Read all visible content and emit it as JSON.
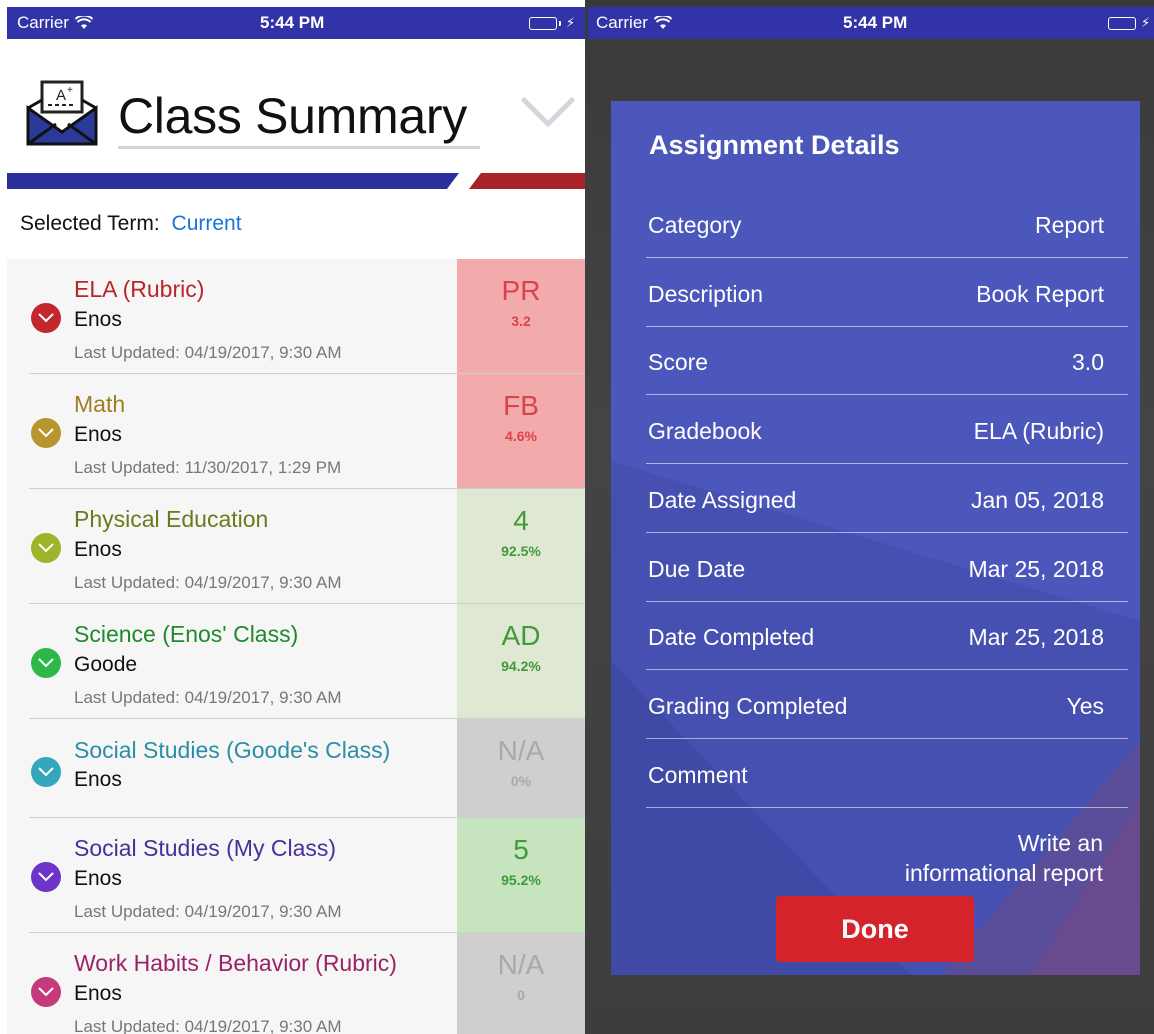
{
  "status_bar": {
    "carrier": "Carrier",
    "time": "5:44 PM"
  },
  "left": {
    "title": "Class Summary",
    "selected_term_label": "Selected Term:",
    "selected_term_value": "Current",
    "classes": [
      {
        "name": "ELA (Rubric)",
        "teacher": "Enos",
        "updated": "Last Updated: 04/19/2017, 9:30 AM",
        "grade": "PR",
        "score": "3.2",
        "name_color": "#b8262b",
        "dot_color": "#c4262d",
        "grade_bg": "#f3aaab",
        "grade_color": "#d9434a"
      },
      {
        "name": "Math",
        "teacher": "Enos",
        "updated": "Last Updated: 11/30/2017, 1:29 PM",
        "grade": "FB",
        "score": "4.6%",
        "name_color": "#a07e22",
        "dot_color": "#b8962e",
        "grade_bg": "#f3aaab",
        "grade_color": "#d9434a"
      },
      {
        "name": "Physical Education",
        "teacher": "Enos",
        "updated": "Last Updated: 04/19/2017, 9:30 AM",
        "grade": "4",
        "score": "92.5%",
        "name_color": "#6b7a1f",
        "dot_color": "#9cb52b",
        "grade_bg": "#dfe8d3",
        "grade_color": "#3f9a3a"
      },
      {
        "name": "Science (Enos' Class)",
        "teacher": "Goode",
        "updated": "Last Updated: 04/19/2017, 9:30 AM",
        "grade": "AD",
        "score": "94.2%",
        "name_color": "#1f8a2e",
        "dot_color": "#2eb84a",
        "grade_bg": "#dfe8d3",
        "grade_color": "#3f9a3a"
      },
      {
        "name": "Social Studies (Goode's Class)",
        "teacher": "Enos",
        "updated": "",
        "grade": "N/A",
        "score": "0%",
        "name_color": "#2a8fa4",
        "dot_color": "#35a7bd",
        "grade_bg": "#cfcfcf",
        "grade_color": "#a9a9a9"
      },
      {
        "name": "Social Studies (My Class)",
        "teacher": "Enos",
        "updated": "Last Updated: 04/19/2017, 9:30 AM",
        "grade": "5",
        "score": "95.2%",
        "name_color": "#4a2f9a",
        "dot_color": "#6c34c8",
        "grade_bg": "#c6e4bd",
        "grade_color": "#3f9a3a"
      },
      {
        "name": "Work Habits / Behavior (Rubric)",
        "teacher": "Enos",
        "updated": "Last Updated: 04/19/2017, 9:30 AM",
        "grade": "N/A",
        "score": "0",
        "name_color": "#9a2366",
        "dot_color": "#c43a7c",
        "grade_bg": "#cfcfcf",
        "grade_color": "#a9a9a9"
      }
    ]
  },
  "right": {
    "modal_title": "Assignment Details",
    "details": [
      {
        "label": "Category",
        "value": "Report"
      },
      {
        "label": "Description",
        "value": "Book Report"
      },
      {
        "label": "Score",
        "value": "3.0"
      },
      {
        "label": "Gradebook",
        "value": "ELA (Rubric)"
      },
      {
        "label": "Date Assigned",
        "value": "Jan 05, 2018"
      },
      {
        "label": "Due Date",
        "value": "Mar 25, 2018"
      },
      {
        "label": "Date Completed",
        "value": "Mar 25, 2018"
      },
      {
        "label": "Grading Completed",
        "value": "Yes"
      },
      {
        "label": "Comment",
        "value": ""
      }
    ],
    "comment_line1": "Write an",
    "comment_line2": "informational report",
    "done_label": "Done"
  }
}
